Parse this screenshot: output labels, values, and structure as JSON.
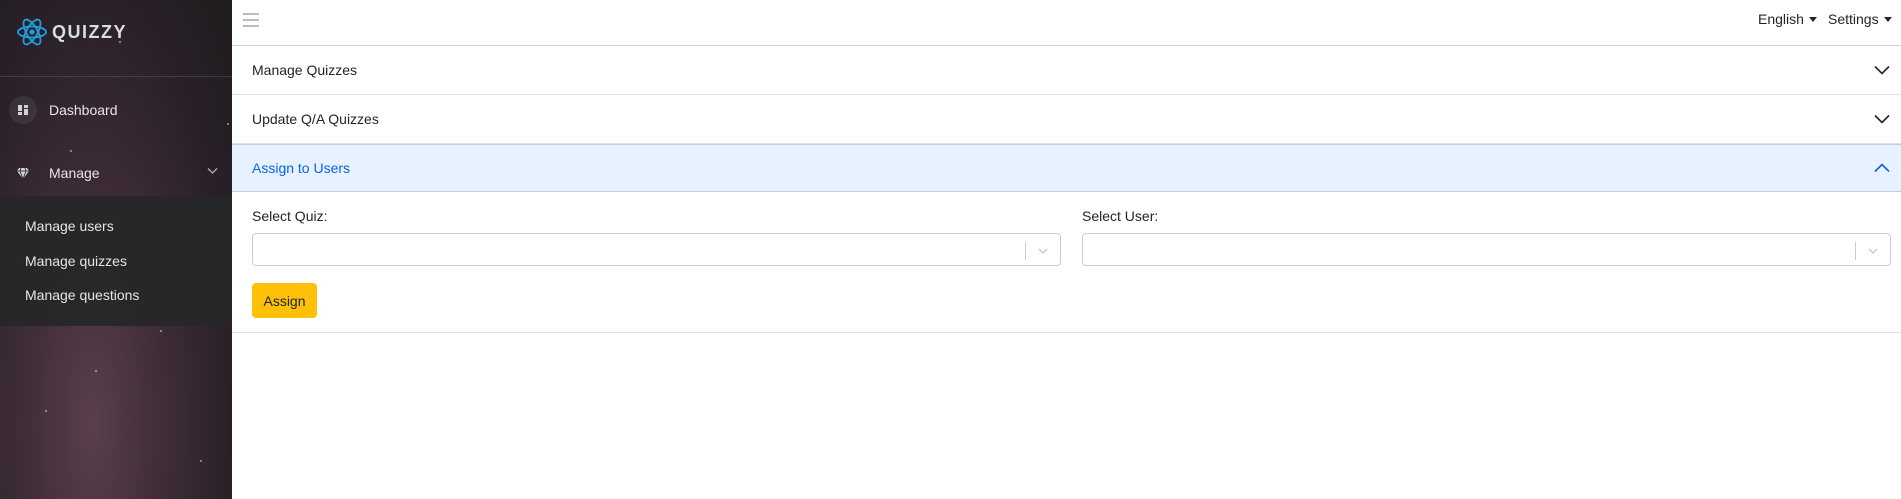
{
  "app": {
    "name": "QUIZZY",
    "logo_icon": "atom-logo-icon"
  },
  "sidebar": {
    "items": [
      {
        "label": "Dashboard",
        "icon": "dashboard-icon"
      },
      {
        "label": "Manage",
        "icon": "diamond-icon",
        "expanded": true
      }
    ],
    "submenu": [
      {
        "label": "Manage users"
      },
      {
        "label": "Manage quizzes"
      },
      {
        "label": "Manage questions"
      }
    ]
  },
  "topbar": {
    "language_label": "English",
    "settings_label": "Settings"
  },
  "accordion": {
    "sections": [
      {
        "title": "Manage Quizzes",
        "expanded": false
      },
      {
        "title": "Update Q/A Quizzes",
        "expanded": false
      },
      {
        "title": "Assign to Users",
        "expanded": true
      }
    ]
  },
  "assign_form": {
    "quiz_label": "Select Quiz:",
    "quiz_value": "",
    "user_label": "Select User:",
    "user_value": "",
    "button_label": "Assign"
  },
  "colors": {
    "accent_active_bg": "#e7f1ff",
    "accent_active_text": "#0c63e4",
    "button_warning": "#ffc107",
    "logo_blue": "#1ba0e1"
  }
}
